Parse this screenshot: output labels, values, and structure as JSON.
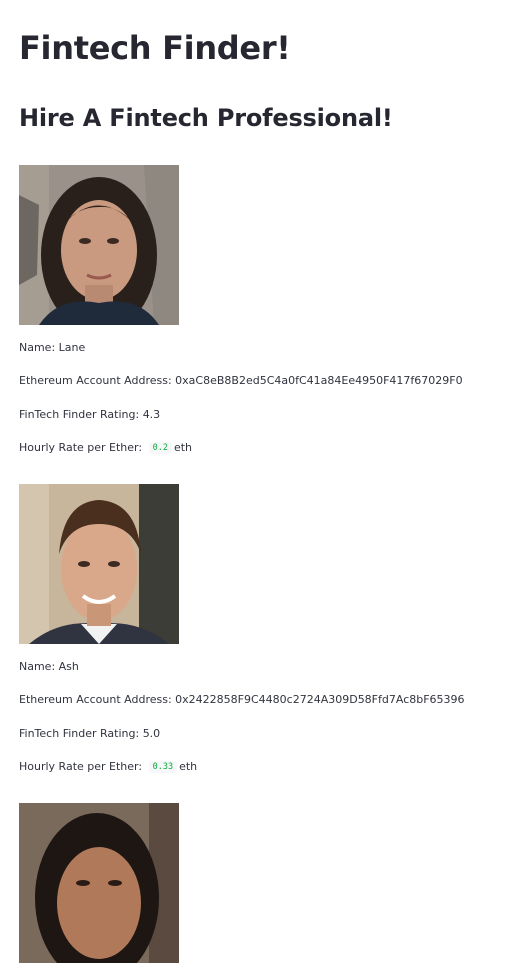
{
  "page": {
    "title": "Fintech Finder!",
    "subtitle": "Hire A Fintech Professional!"
  },
  "labels": {
    "name": "Name: ",
    "address": "Ethereum Account Address: ",
    "rating": "FinTech Finder Rating: ",
    "rate": "Hourly Rate per Ether: ",
    "unit": "eth"
  },
  "candidates": [
    {
      "name": "Lane",
      "address": "0xaC8eB8B2ed5C4a0fC41a84Ee4950F417f67029F0",
      "rating": "4.3",
      "rate": "0.2"
    },
    {
      "name": "Ash",
      "address": "0x2422858F9C4480c2724A309D58Ffd7Ac8bF65396",
      "rating": "5.0",
      "rate": "0.33"
    },
    {}
  ]
}
